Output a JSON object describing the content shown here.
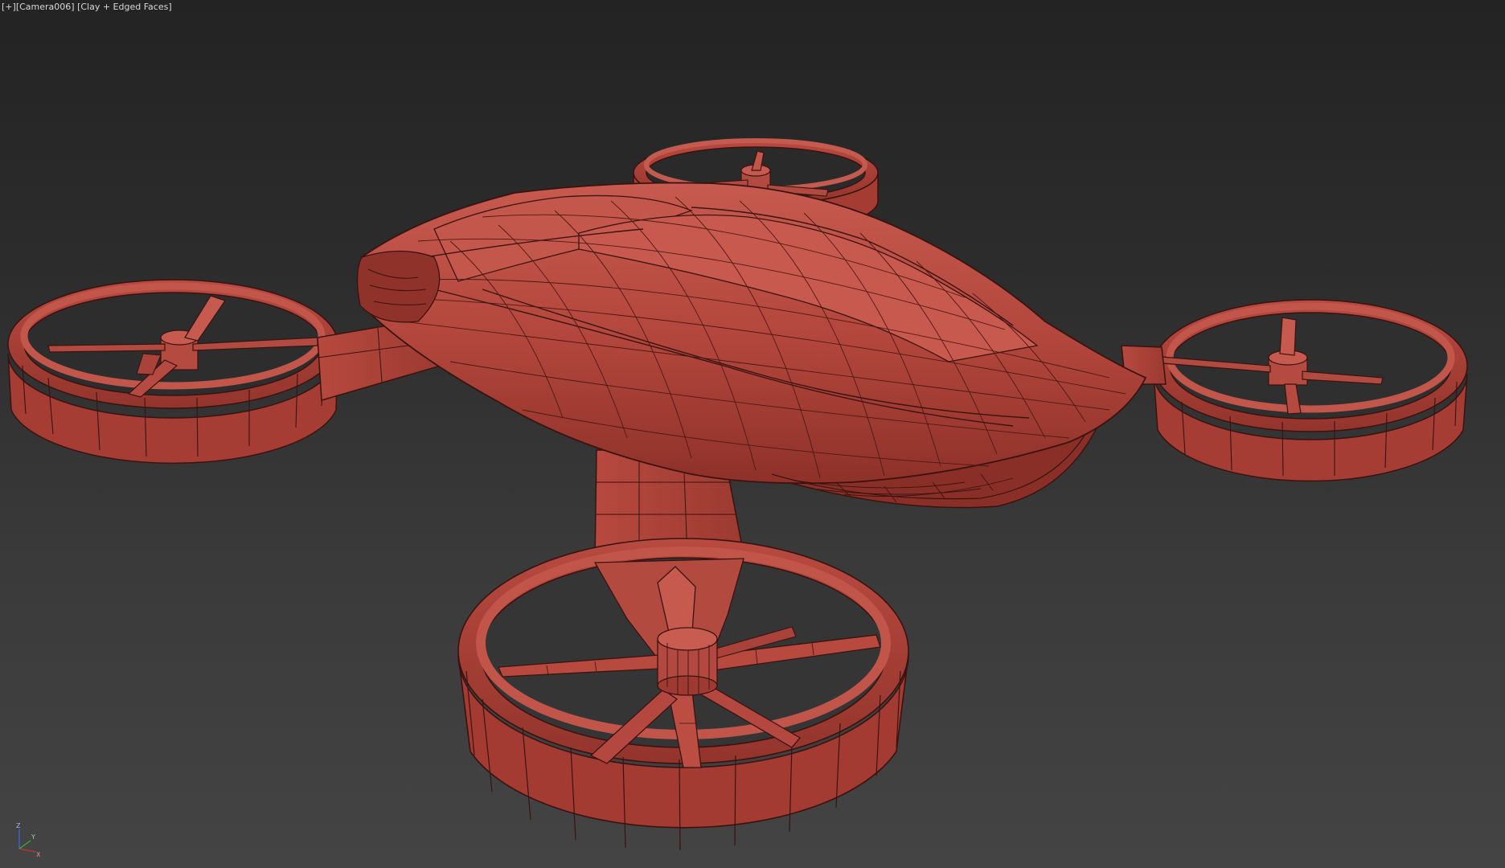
{
  "viewport": {
    "label_menu": "[+]",
    "label_camera": "[Camera006]",
    "label_shading": "[Clay + Edged Faces]"
  },
  "axis_gizmo": {
    "z_label": "Z",
    "x_label": "X",
    "y_label": "Y",
    "colors": {
      "x": "#c83232",
      "y": "#32b432",
      "z": "#3c64dc"
    }
  },
  "model": {
    "clay_color": "#b5463c",
    "edge_color": "#3a1310"
  }
}
